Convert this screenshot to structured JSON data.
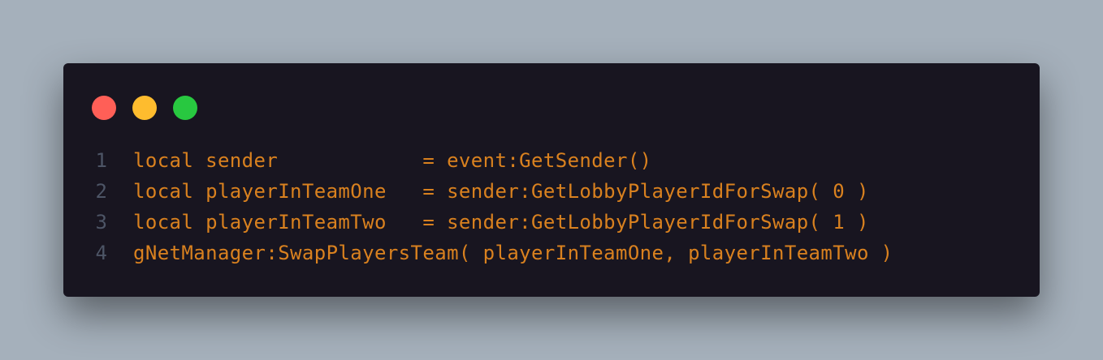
{
  "colors": {
    "background": "#a5b0bb",
    "window": "#181520",
    "code_text": "#d9811f",
    "line_number": "#4d5566"
  },
  "window_controls": [
    {
      "name": "close",
      "color": "#ff5f57"
    },
    {
      "name": "minimize",
      "color": "#febc2e"
    },
    {
      "name": "maximize",
      "color": "#28c840"
    }
  ],
  "code": {
    "lines": [
      {
        "number": "1",
        "text": "local sender            = event:GetSender()"
      },
      {
        "number": "2",
        "text": "local playerInTeamOne   = sender:GetLobbyPlayerIdForSwap( 0 )"
      },
      {
        "number": "3",
        "text": "local playerInTeamTwo   = sender:GetLobbyPlayerIdForSwap( 1 )"
      },
      {
        "number": "4",
        "text": "gNetManager:SwapPlayersTeam( playerInTeamOne, playerInTeamTwo )"
      }
    ]
  }
}
